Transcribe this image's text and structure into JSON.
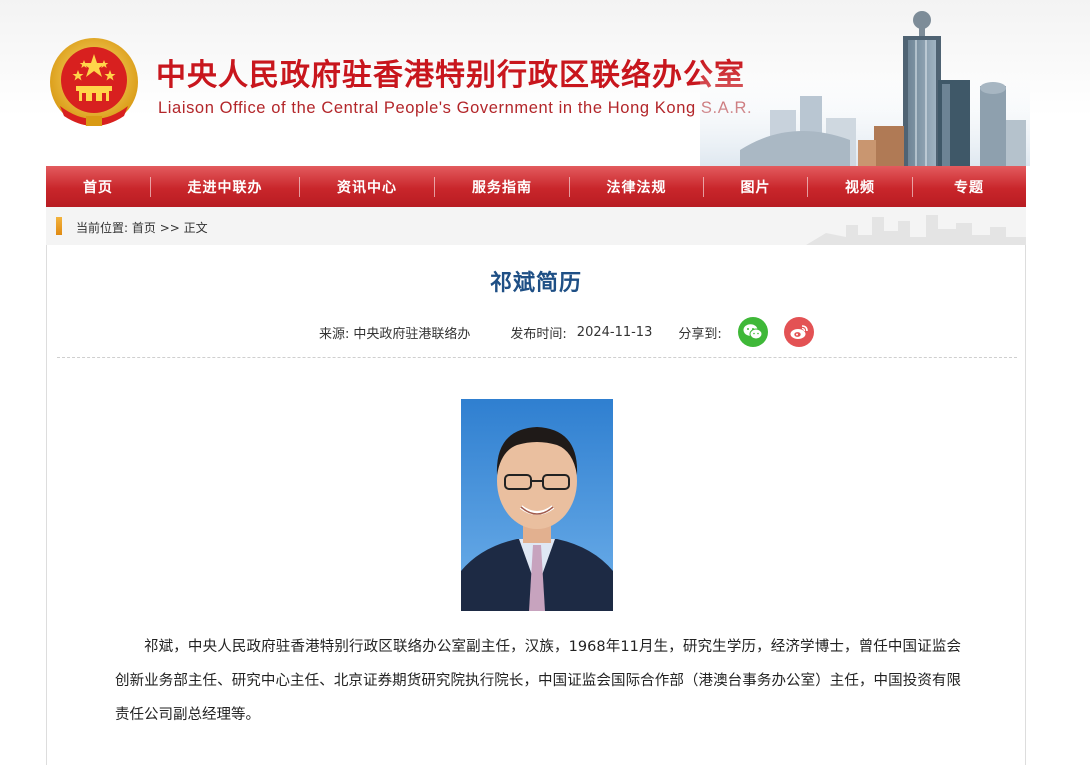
{
  "header": {
    "title_cn": "中央人民政府驻香港特别行政区联络办公室",
    "title_en": "Liaison Office of the Central People's Government in the Hong Kong S.A.R."
  },
  "nav": {
    "items": [
      "首页",
      "走进中联办",
      "资讯中心",
      "服务指南",
      "法律法规",
      "图片",
      "视频",
      "专题"
    ]
  },
  "breadcrumb": {
    "prefix": "当前位置:",
    "home": "首页",
    "separator": ">>",
    "current": "正文"
  },
  "article": {
    "title": "祁斌简历",
    "source_label": "来源:",
    "source": "中央政府驻港联络办",
    "date_label": "发布时间:",
    "date": "2024-11-13",
    "share_label": "分享到:",
    "body": "祁斌，中央人民政府驻香港特别行政区联络办公室副主任，汉族，1968年11月生，研究生学历，经济学博士，曾任中国证监会创新业务部主任、研究中心主任、北京证券期货研究院执行院长，中国证监会国际合作部（港澳台事务办公室）主任，中国投资有限责任公司副总经理等。"
  },
  "icons": {
    "emblem": "national-emblem-icon",
    "share_wechat": "wechat-icon",
    "share_weibo": "weibo-icon"
  },
  "colors": {
    "brand_red": "#c8161d",
    "nav_red": "#c9262b",
    "title_blue": "#1e4f85",
    "wechat_green": "#3fb838",
    "weibo_red": "#e35254"
  }
}
